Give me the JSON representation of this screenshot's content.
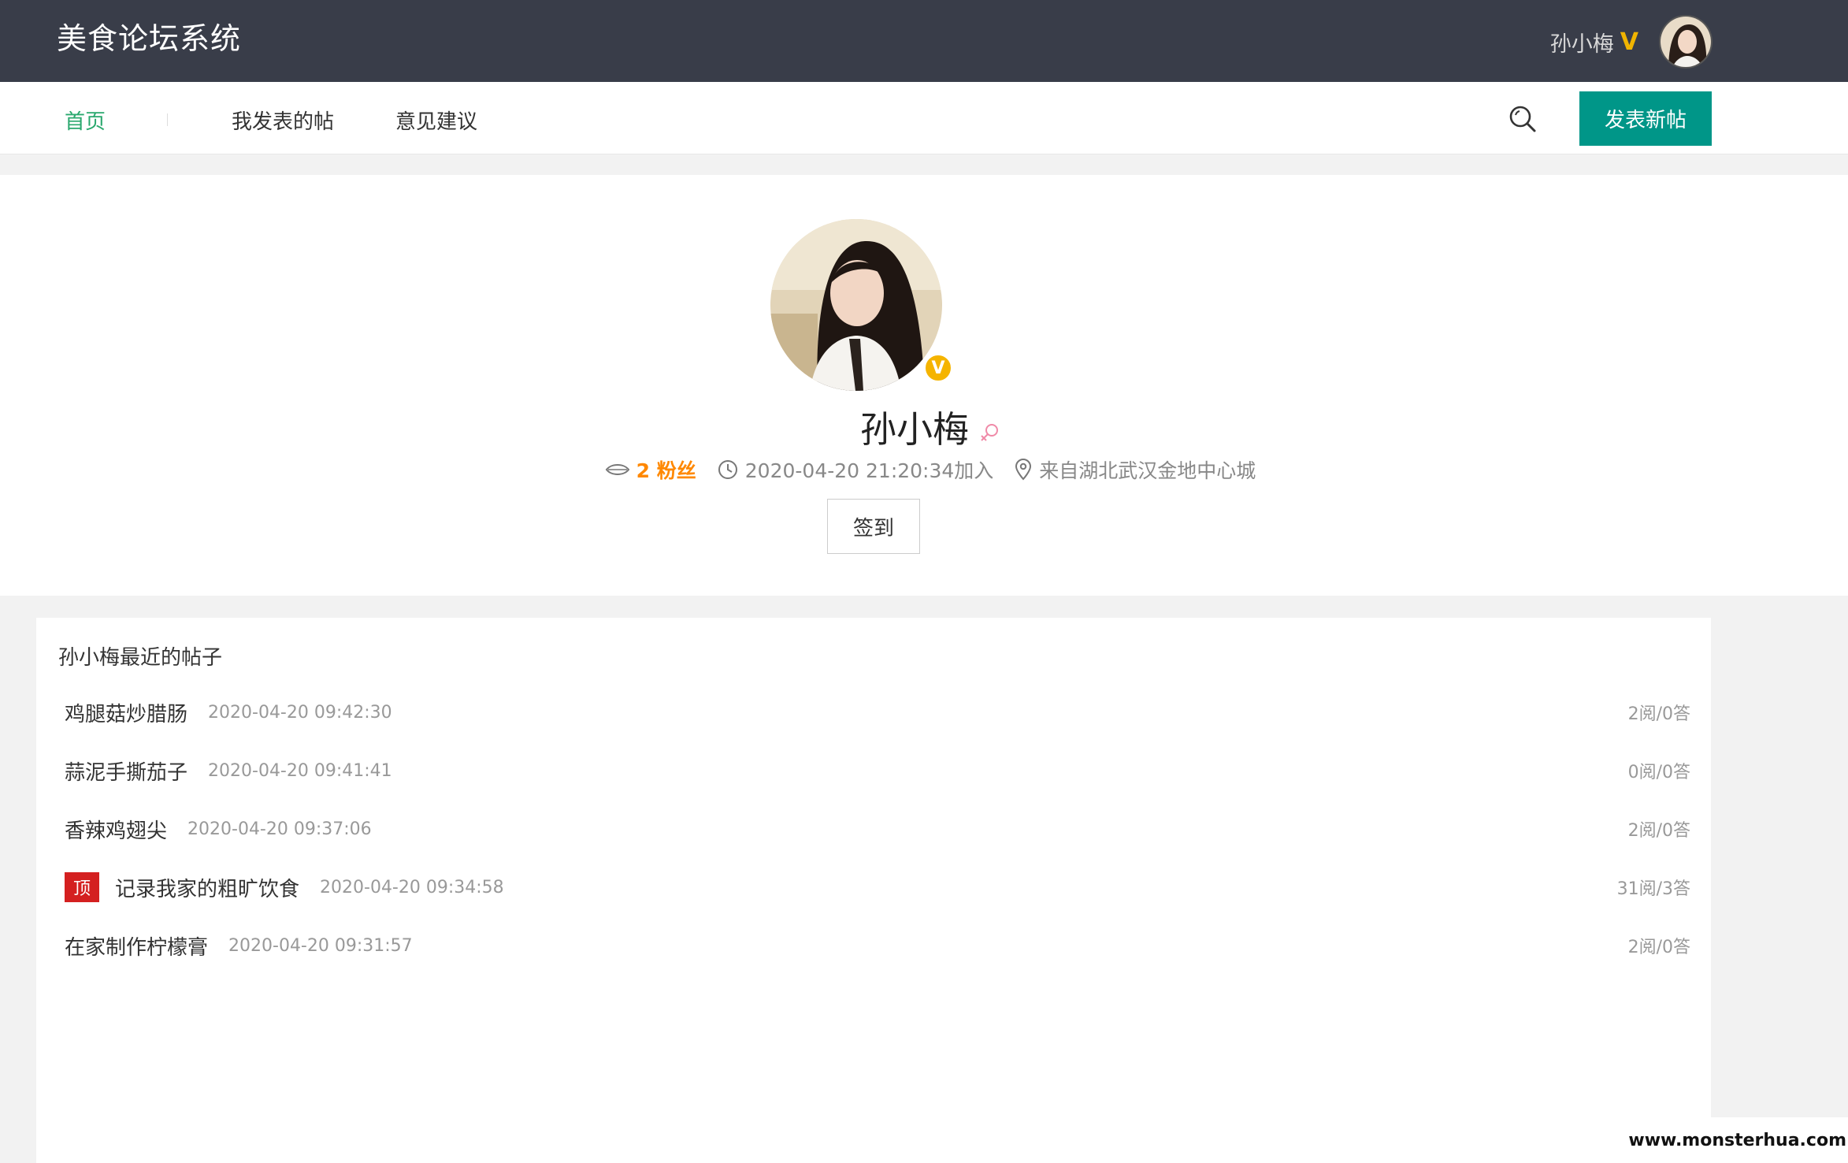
{
  "header": {
    "logo": "美食论坛系统",
    "user_name": "孙小梅",
    "vip_mark": "V"
  },
  "nav": {
    "items": [
      {
        "label": "首页",
        "active": true
      },
      {
        "label": "我发表的帖"
      },
      {
        "label": "意见建议"
      }
    ],
    "post_button": "发表新帖"
  },
  "profile": {
    "name": "孙小梅",
    "verify_mark": "V",
    "fans": "2 粉丝",
    "joined": "2020-04-20 21:20:34加入",
    "location": "来自湖北武汉金地中心城",
    "signin_button": "签到"
  },
  "posts": {
    "title": "孙小梅最近的帖子",
    "top_badge": "顶",
    "items": [
      {
        "title": "鸡腿菇炒腊肠",
        "time": "2020-04-20 09:42:30",
        "stats": "2阅/0答"
      },
      {
        "title": "蒜泥手撕茄子",
        "time": "2020-04-20 09:41:41",
        "stats": "0阅/0答"
      },
      {
        "title": "香辣鸡翅尖",
        "time": "2020-04-20 09:37:06",
        "stats": "2阅/0答"
      },
      {
        "title": "记录我家的粗旷饮食",
        "time": "2020-04-20 09:34:58",
        "stats": "31阅/3答",
        "pinned": true
      },
      {
        "title": "在家制作柠檬膏",
        "time": "2020-04-20 09:31:57",
        "stats": "2阅/0答"
      }
    ]
  },
  "watermark": "www.monsterhua.com",
  "colors": {
    "header_bg": "#393d49",
    "accent_green": "#009688",
    "nav_active": "#2aa86e",
    "fans_orange": "#ff8800",
    "vip_gold": "#f5b400",
    "pinned_red": "#d42020"
  }
}
